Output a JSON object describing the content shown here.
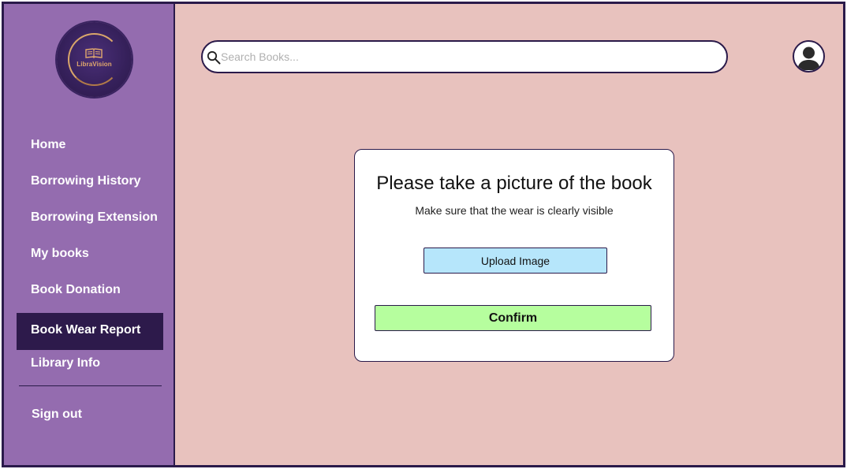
{
  "app": {
    "logo_text": "LibraVision"
  },
  "sidebar": {
    "items": [
      {
        "label": "Home"
      },
      {
        "label": "Borrowing History"
      },
      {
        "label": "Borrowing Extension"
      },
      {
        "label": "My books"
      },
      {
        "label": "Book Donation"
      },
      {
        "label": "Book Wear Report",
        "active": true
      },
      {
        "label": "Library Info"
      }
    ],
    "sign_out": "Sign out"
  },
  "header": {
    "search_placeholder": "Search Books...",
    "search_value": "",
    "search_icon": "search-icon",
    "avatar_icon": "user-avatar-icon"
  },
  "dialog": {
    "title": "Please take a picture of the book",
    "subtitle": "Make sure that the wear is clearly visible",
    "upload_label": "Upload Image",
    "confirm_label": "Confirm"
  },
  "colors": {
    "sidebar_bg": "#946caf",
    "sidebar_active": "#2d1a4b",
    "page_bg": "#e8c2be",
    "upload_btn": "#b6e6fb",
    "confirm_btn": "#b6fe9e",
    "border": "#2a1a4a"
  }
}
